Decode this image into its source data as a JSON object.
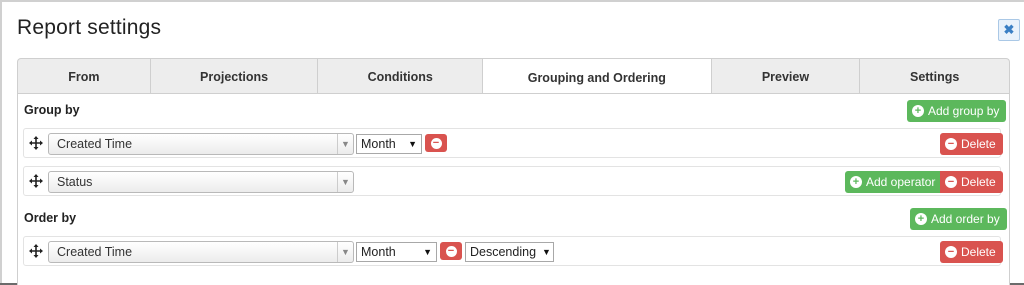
{
  "dialog": {
    "title": "Report settings"
  },
  "tabs": [
    {
      "label": "From"
    },
    {
      "label": "Projections"
    },
    {
      "label": "Conditions"
    },
    {
      "label": "Grouping and Ordering",
      "active": true
    },
    {
      "label": "Preview"
    },
    {
      "label": "Settings"
    }
  ],
  "group_by": {
    "label": "Group by",
    "add_label": "Add group by",
    "rows": [
      {
        "field": "Created Time",
        "period": "Month",
        "delete_label": "Delete"
      },
      {
        "field": "Status",
        "add_operator_label": "Add operator",
        "delete_label": "Delete"
      }
    ]
  },
  "order_by": {
    "label": "Order by",
    "add_label": "Add order by",
    "rows": [
      {
        "field": "Created Time",
        "period": "Month",
        "direction": "Descending",
        "delete_label": "Delete"
      }
    ]
  },
  "colors": {
    "success": "#5cb85c",
    "danger": "#d9534f"
  }
}
